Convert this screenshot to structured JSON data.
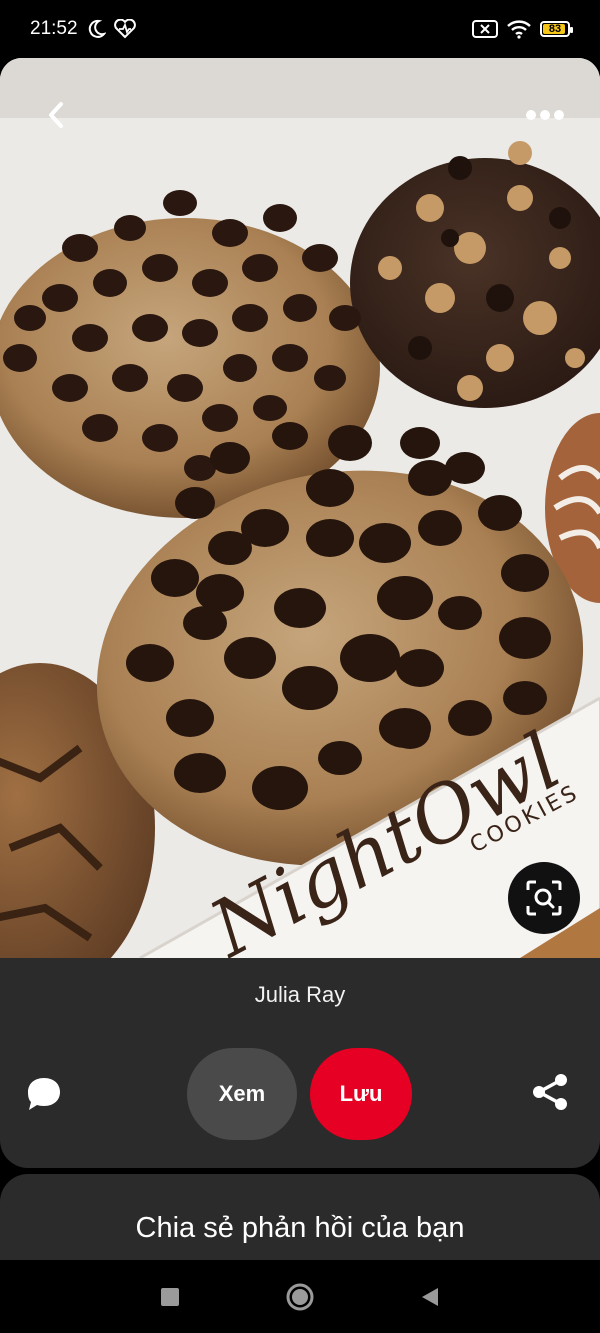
{
  "status_bar": {
    "time": "21:52",
    "battery_level": "83",
    "icons": [
      "moon-icon",
      "heart-pulse-icon",
      "sim-off-icon",
      "wifi-icon",
      "battery-icon"
    ]
  },
  "pin": {
    "image_description_icons": [
      "back-arrow-icon",
      "more-options-icon",
      "visual-search-icon"
    ],
    "author": "Julia Ray"
  },
  "actions": {
    "view_label": "Xem",
    "save_label": "Lưu",
    "comment_icon": "comment-icon",
    "share_icon": "share-icon"
  },
  "feedback": {
    "title": "Chia sẻ phản hồi của bạn"
  },
  "navigation": {
    "buttons": [
      "recent-apps-icon",
      "home-icon",
      "back-icon"
    ]
  },
  "colors": {
    "save_button": "#e60023",
    "panel_bg": "#2b2b2b",
    "view_button": "#4a4a4a"
  }
}
